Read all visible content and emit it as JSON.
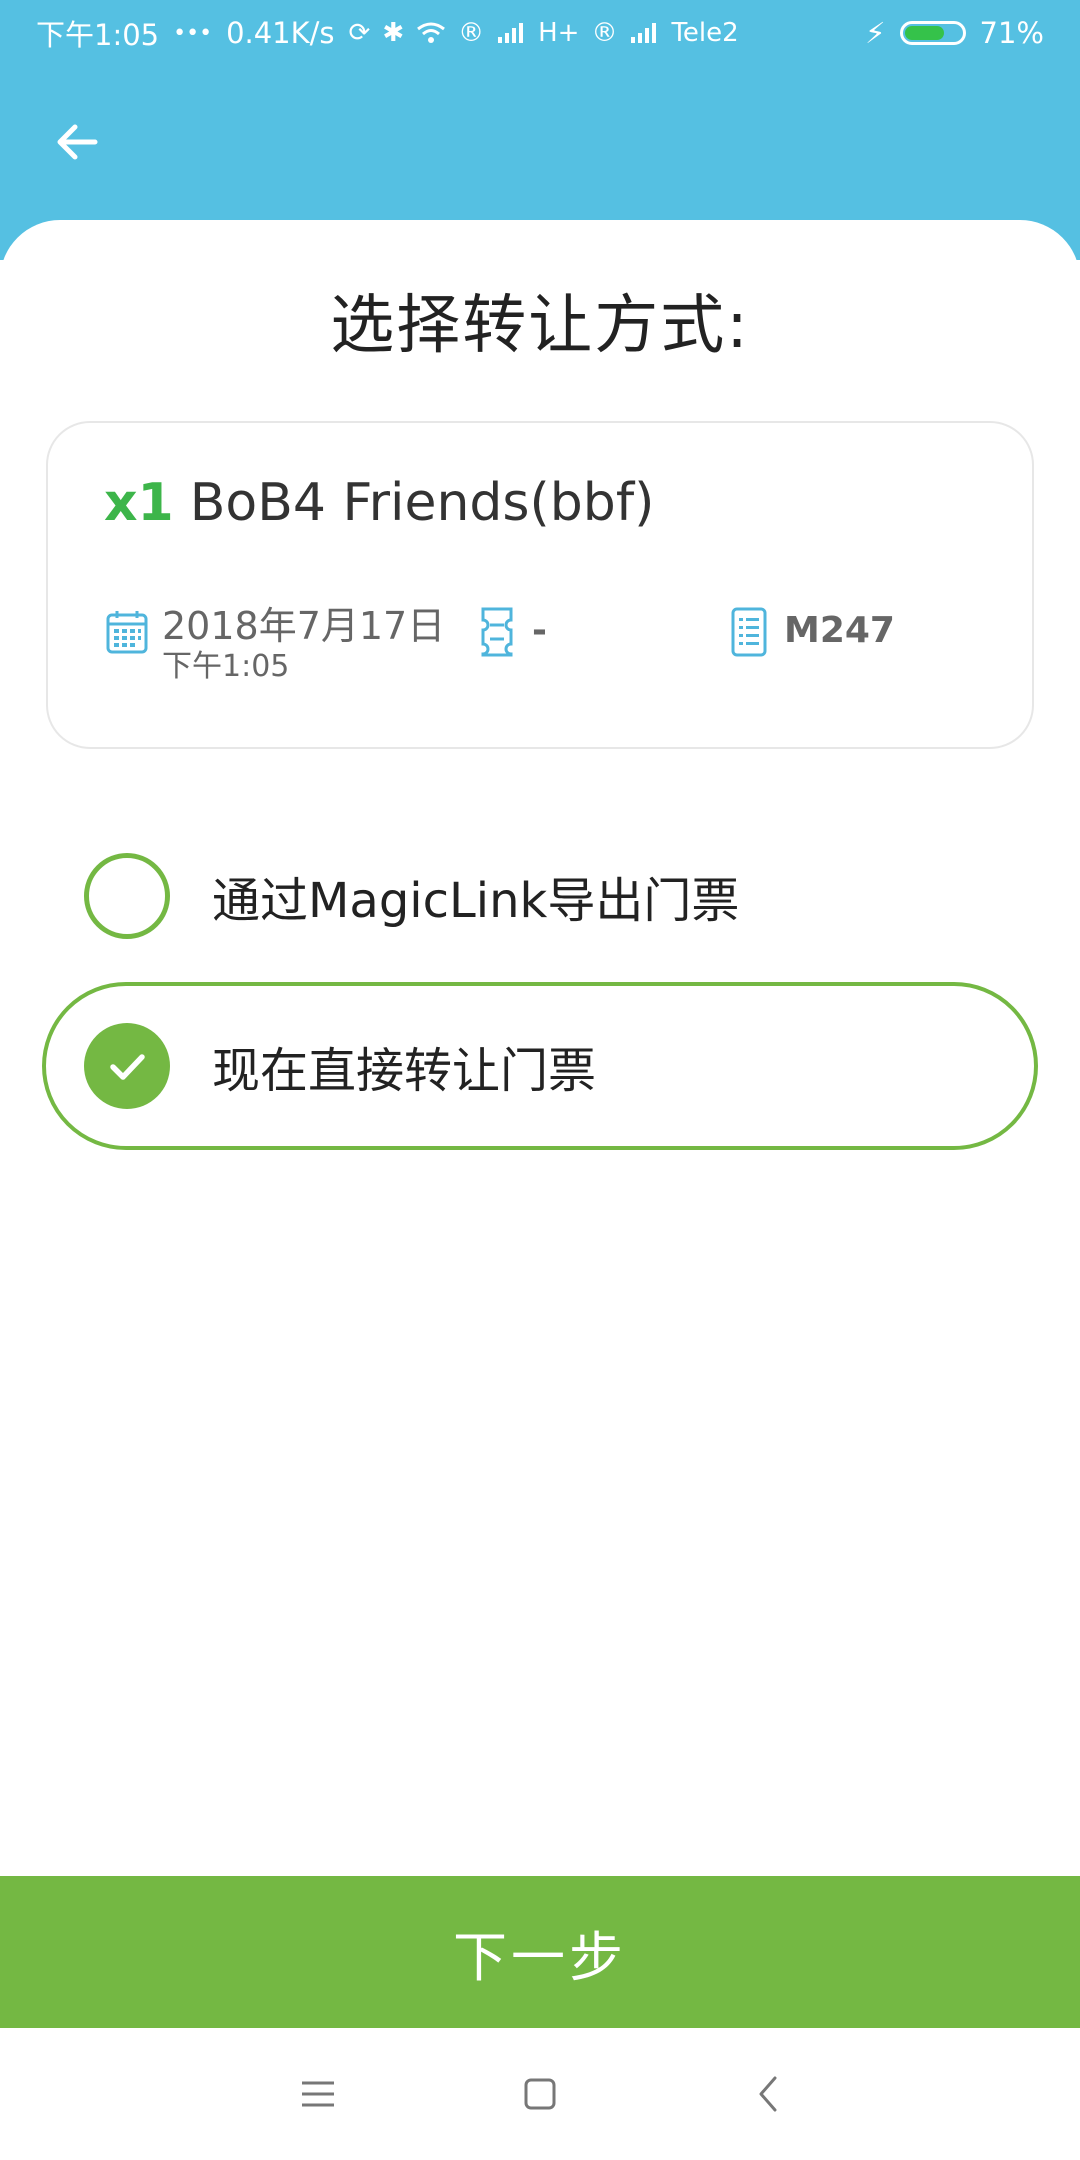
{
  "status_bar": {
    "time": "下午1:05",
    "dots": "•••",
    "net_speed": "0.41K/s",
    "network": "H+",
    "carrier": "Tele2",
    "battery_percent": "71%",
    "battery_level": 0.71
  },
  "header": {
    "background": "#55c0e2"
  },
  "title": "选择转让方式:",
  "ticket": {
    "quantity": "x1",
    "name": "BoB4 Friends(bbf)",
    "date": "2018年7月17日",
    "time": "下午1:05",
    "seat": "-",
    "order": "M247"
  },
  "options": [
    {
      "label": "通过MagicLink导出门票",
      "selected": false
    },
    {
      "label": "现在直接转让门票",
      "selected": true
    }
  ],
  "next_button": "下一步",
  "colors": {
    "accent_green": "#74b843",
    "quantity_green": "#3db54a",
    "icon_blue": "#4fb5dc",
    "battery_green": "#35c24a"
  }
}
